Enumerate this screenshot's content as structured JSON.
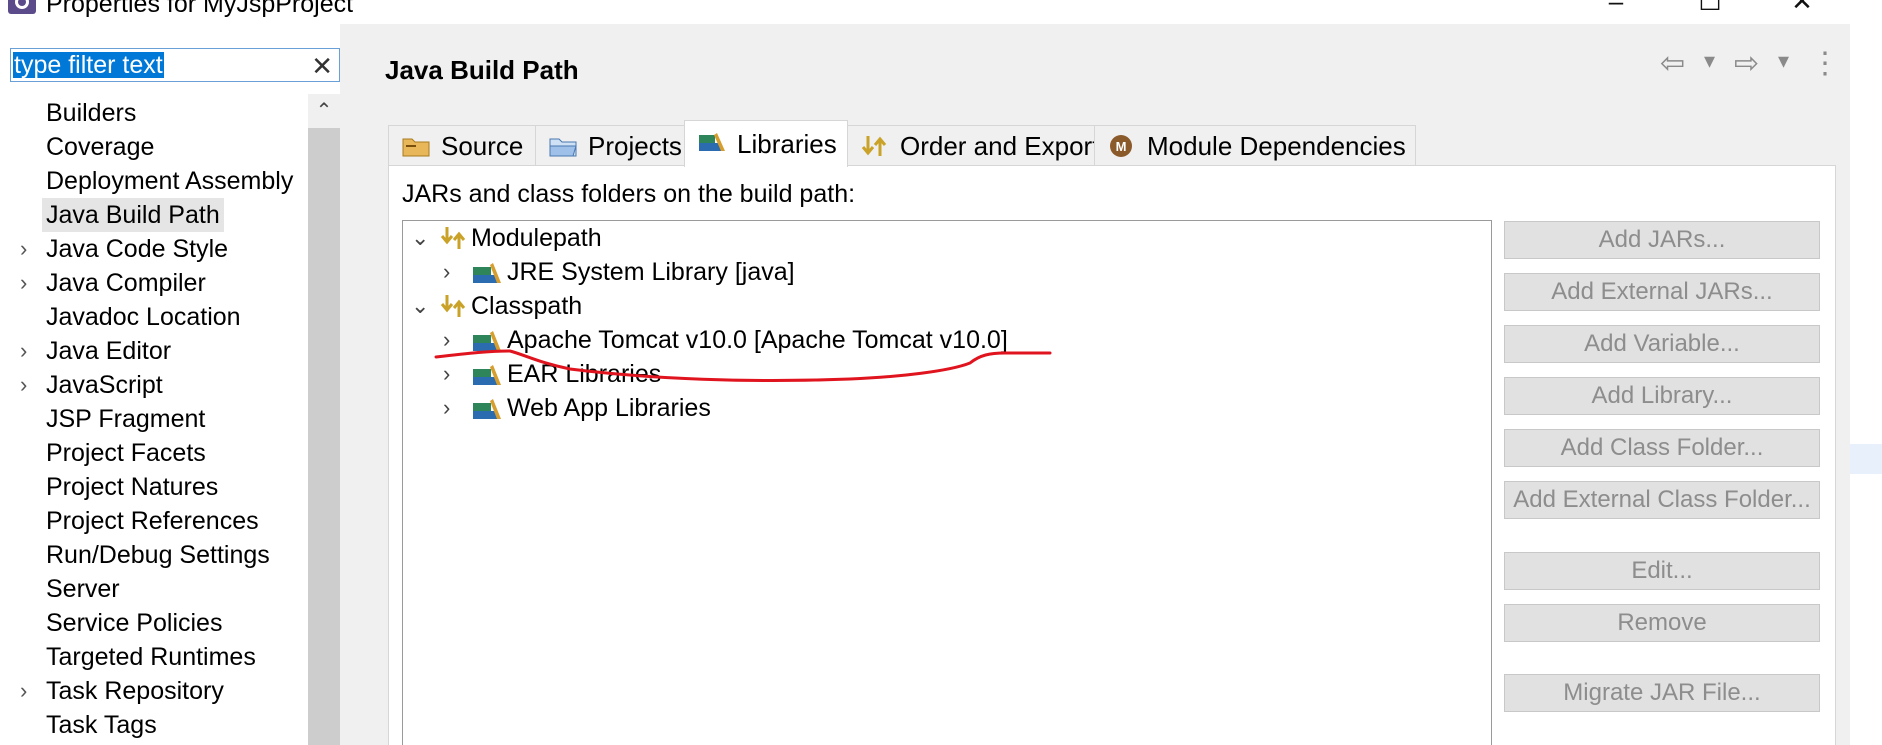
{
  "window": {
    "title": "Properties for MyJspProject",
    "controls": {
      "minimize": "–",
      "maximize": "☐",
      "close": "✕"
    }
  },
  "filter": {
    "placeholder": "type filter text",
    "value": "type filter text",
    "clear": "✕"
  },
  "sidebar": {
    "scroll_up": "⌃",
    "items": [
      {
        "label": "Builders",
        "expandable": false
      },
      {
        "label": "Coverage",
        "expandable": false
      },
      {
        "label": "Deployment Assembly",
        "expandable": false
      },
      {
        "label": "Java Build Path",
        "expandable": false,
        "selected": true
      },
      {
        "label": "Java Code Style",
        "expandable": true
      },
      {
        "label": "Java Compiler",
        "expandable": true
      },
      {
        "label": "Javadoc Location",
        "expandable": false
      },
      {
        "label": "Java Editor",
        "expandable": true
      },
      {
        "label": "JavaScript",
        "expandable": true
      },
      {
        "label": "JSP Fragment",
        "expandable": false
      },
      {
        "label": "Project Facets",
        "expandable": false
      },
      {
        "label": "Project Natures",
        "expandable": false
      },
      {
        "label": "Project References",
        "expandable": false
      },
      {
        "label": "Run/Debug Settings",
        "expandable": false
      },
      {
        "label": "Server",
        "expandable": false
      },
      {
        "label": "Service Policies",
        "expandable": false
      },
      {
        "label": "Targeted Runtimes",
        "expandable": false
      },
      {
        "label": "Task Repository",
        "expandable": true
      },
      {
        "label": "Task Tags",
        "expandable": false
      }
    ]
  },
  "page": {
    "title": "Java Build Path",
    "nav": {
      "back": "⇦",
      "back_menu": "▾",
      "forward": "⇨",
      "forward_menu": "▾",
      "more": "⋮"
    }
  },
  "tabs": [
    {
      "label": "Source",
      "icon": "source-folder-icon"
    },
    {
      "label": "Projects",
      "icon": "projects-folder-icon"
    },
    {
      "label": "Libraries",
      "icon": "libraries-icon",
      "active": true
    },
    {
      "label": "Order and Export",
      "icon": "order-export-icon"
    },
    {
      "label": "Module Dependencies",
      "icon": "module-icon"
    }
  ],
  "libraries": {
    "label": "JARs and class folders on the build path:",
    "tree": [
      {
        "label": "Modulepath",
        "level": 0,
        "expanded": true,
        "icon": "path-container-icon"
      },
      {
        "label": "JRE System Library [java]",
        "level": 1,
        "expanded": false,
        "icon": "library-icon"
      },
      {
        "label": "Classpath",
        "level": 0,
        "expanded": true,
        "icon": "path-container-icon"
      },
      {
        "label": "Apache Tomcat v10.0 [Apache Tomcat v10.0]",
        "level": 1,
        "expanded": false,
        "icon": "library-icon",
        "annotated": true
      },
      {
        "label": "EAR Libraries",
        "level": 1,
        "expanded": false,
        "icon": "library-icon"
      },
      {
        "label": "Web App Libraries",
        "level": 1,
        "expanded": false,
        "icon": "library-icon"
      }
    ],
    "buttons": [
      {
        "label": "Add JARs...",
        "enabled": false
      },
      {
        "label": "Add External JARs...",
        "enabled": false
      },
      {
        "label": "Add Variable...",
        "enabled": false
      },
      {
        "label": "Add Library...",
        "enabled": false
      },
      {
        "label": "Add Class Folder...",
        "enabled": false
      },
      {
        "label": "Add External Class Folder...",
        "enabled": false
      },
      {
        "label": "Edit...",
        "enabled": false
      },
      {
        "label": "Remove",
        "enabled": false
      },
      {
        "label": "Migrate JAR File...",
        "enabled": false
      }
    ]
  },
  "colors": {
    "selection_blue": "#0078d7",
    "annotation_red": "#e0141e",
    "disabled_text": "#8d8d8d",
    "panel_bg": "#f0f0f0"
  }
}
